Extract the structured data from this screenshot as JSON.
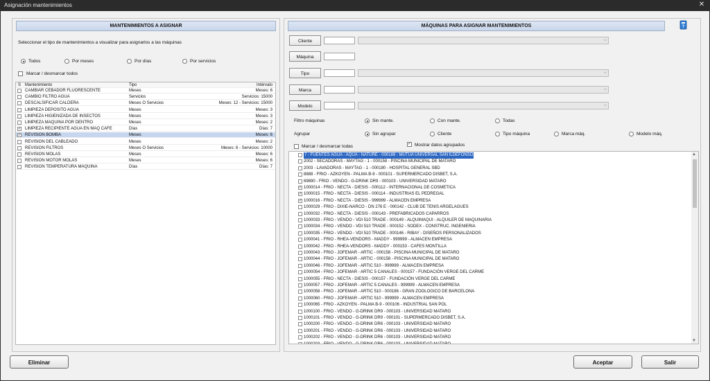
{
  "window": {
    "title": "Asignación mantenimientos"
  },
  "left": {
    "header": "MANTENIMIENTOS A ASIGNAR",
    "instruction": "Seleccionar el tipo de mantenimientos a visualizar para asignarlos a las máquinas",
    "filter_options": [
      {
        "label": "Todos",
        "selected": true
      },
      {
        "label": "Por meses",
        "selected": false
      },
      {
        "label": "Por días",
        "selected": false
      },
      {
        "label": "Por servicios",
        "selected": false
      }
    ],
    "mark_all_label": "Marcar / desmarcar todos",
    "columns": [
      "S",
      "Mantenimiento",
      "Tipo",
      "Intérvalo"
    ],
    "rows": [
      {
        "checked": false,
        "name": "CAMBIAR CEBADOR FLUORESCENTE",
        "tipo": "Meses",
        "intervalo": "Meses: 6"
      },
      {
        "checked": false,
        "name": "CAMBIO FILTRO AGUA",
        "tipo": "Servicios",
        "intervalo": "Servicios: 15000"
      },
      {
        "checked": false,
        "name": "DESCALSIFICAR CALDERA",
        "tipo": "Meses Ó Servicios",
        "intervalo": "Meses: 12 - Servicios: 15000"
      },
      {
        "checked": false,
        "name": "LIMPIEZA DEPOSITO AGUA",
        "tipo": "Meses",
        "intervalo": "Meses: 3"
      },
      {
        "checked": false,
        "name": "LIMPIEZA HIGIENIZADA DE INSECTOS",
        "tipo": "Meses",
        "intervalo": "Meses: 3"
      },
      {
        "checked": false,
        "name": "LIMPIEZA MAQUINA POR DENTRO",
        "tipo": "Meses",
        "intervalo": "Meses: 2"
      },
      {
        "checked": true,
        "name": "LIMPIEZA RECIPIENTE AGUA EN MAQ CAFE",
        "tipo": "Días",
        "intervalo": "Días: 7"
      },
      {
        "checked": true,
        "name": "REVISION BOMBA",
        "tipo": "Meses",
        "intervalo": "Meses: 6",
        "selected": true
      },
      {
        "checked": false,
        "name": "REVISIÓN DEL CABLEADO",
        "tipo": "Meses",
        "intervalo": "Meses: 2"
      },
      {
        "checked": false,
        "name": "REVISIÓN FILTROS",
        "tipo": "Meses Ó Servicios",
        "intervalo": "Meses: 6 - Servicios: 10000"
      },
      {
        "checked": false,
        "name": "REVISIÓN MOLAS",
        "tipo": "Meses",
        "intervalo": "Meses: 6"
      },
      {
        "checked": false,
        "name": "REVISIÓN MOTOR MOLAS",
        "tipo": "Meses",
        "intervalo": "Meses: 6"
      },
      {
        "checked": false,
        "name": "REVISIÓN TEMPERATURA MAQUINA",
        "tipo": "Días",
        "intervalo": "Días: 7"
      }
    ]
  },
  "right": {
    "header": "MÁQUINAS PARA ASIGNAR MANTENIMIENTOS",
    "help_icon": "help-book-icon",
    "field_buttons": [
      "Cliente",
      "Máquina",
      "Tipo",
      "Marca",
      "Modelo"
    ],
    "filtro_label": "Filtro máquinas",
    "filtro_options": [
      {
        "label": "Sin mante.",
        "selected": true
      },
      {
        "label": "Con mante.",
        "selected": false
      },
      {
        "label": "Todas",
        "selected": false
      }
    ],
    "agrupar_label": "Agrupar",
    "agrupar_options": [
      {
        "label": "Sin agrupar",
        "selected": true
      },
      {
        "label": "Cliente",
        "selected": false
      },
      {
        "label": "Tipo máquina",
        "selected": false
      },
      {
        "label": "Marca máq.",
        "selected": false
      },
      {
        "label": "Modelo máq.",
        "selected": false
      }
    ],
    "mark_all_label": "Marcar / desmarcar todas",
    "show_grouped_label": "Mostrar datos agrupados",
    "show_grouped_checked": true,
    "machines": [
      {
        "checked": false,
        "text": "7 - FUENTES AGUA - AQUA - NATURE - 000189 - MUTUA UNIVERSAL SAN ILDEFONSO",
        "highlight": true
      },
      {
        "checked": false,
        "text": "2002 - SECADORAS - MAYTAG - 1 - 000158 - PISCINA MUNICIPAL DE MATARO"
      },
      {
        "checked": false,
        "text": "2003 - LAVADORAS - MAYTAG - 1 - 000180 - HOSPITAL GENERAL SBD"
      },
      {
        "checked": false,
        "text": "8888 - FRIO - AZKOYEN - PALMA B-9 - 000101 - SUPERMERCADO DISBET, S.A."
      },
      {
        "checked": false,
        "text": "69890 - FRIO - VENDO - G-DRINK DR9 - 000103 - UNIVERSIDAD MATARO"
      },
      {
        "checked": true,
        "text": "1000014 - FRIO - NECTA - DIESIS - 000112 - INTERNACIONAL DE COSMETICA"
      },
      {
        "checked": true,
        "text": "1000015 - FRIO - NECTA - DIESIS - 000114 - INDUSTRIAS EL PEDREGAL"
      },
      {
        "checked": true,
        "text": "1000016 - FRIO - NECTA - DIESIS - 999999 - ALMACEN EMPRESA"
      },
      {
        "checked": false,
        "text": "1000029 - FRIO - DIXIE-NARCO - DN 276 E - 000142 - CLUB DE TENIS ARGELAGUES"
      },
      {
        "checked": false,
        "text": "1000032 - FRIO - NECTA - DIESIS - 000143 - PREFABRICADOS CAPARROS"
      },
      {
        "checked": false,
        "text": "1000033 - FRIO - VENDO - VDI 510 TRADE - 000149 - ALQUIMAQUI - ALQUILER DE MAQUINARIA"
      },
      {
        "checked": false,
        "text": "1000034 - FRIO - VENDO - VDI 510 TRADE - 000152 - SODEX - CONSTRUC. INGENIERIA"
      },
      {
        "checked": false,
        "text": "1000035 - FRIO - VENDO - VDI 510 TRADE - 000146 - RIBAY - DISEÑOS PERSONALIZADOS"
      },
      {
        "checked": false,
        "text": "1000041 - FRIO - RHEA-VENDORS - MADDY - 999999 - ALMACEN EMPRESA"
      },
      {
        "checked": false,
        "text": "1000042 - FRIO - RHEA-VENDORS - MADDY - 000153 - CAFES MONTILLA"
      },
      {
        "checked": false,
        "text": "1000043 - FRIO - JOFEMAR - ARTIC - 000158 - PISCINA MUNICIPAL DE MATARO"
      },
      {
        "checked": false,
        "text": "1000044 - FRIO - JOFEMAR - ARTIC - 000158 - PISCINA MUNICIPAL DE MATARO"
      },
      {
        "checked": false,
        "text": "1000046 - FRIO - JOFEMAR - ARTIC 510 - 999999 - ALMACEN EMPRESA"
      },
      {
        "checked": false,
        "text": "1000054 - FRIO - JOFEMAR - ARTIC 5 CANALES - 000157 - FUNDACIÓN VERGE DEL CARME"
      },
      {
        "checked": false,
        "text": "1000055 - FRIO - NECTA - DIESIS - 000157 - FUNDACIÓN VERGE DEL CARME"
      },
      {
        "checked": false,
        "text": "1000057 - FRIO - JOFEMAR - ARTIC 5 CANALES - 999999 - ALMACEN EMPRESA"
      },
      {
        "checked": false,
        "text": "1000058 - FRIO - JOFEMAR - ARTIC 510 - 000186 - GRAN ZOOLOGICO DE BARCELONA"
      },
      {
        "checked": false,
        "text": "1000060 - FRIO - JOFEMAR - ARTIC 510 - 999999 - ALMACEN EMPRESA"
      },
      {
        "checked": false,
        "text": "1000065 - FRIO - AZKOYEN - PALMA B-9 - 000106 - INDUSTRIAL SAN POL"
      },
      {
        "checked": false,
        "text": "1000100 - FRIO - VENDO - G-DRINK DR9 - 000103 - UNIVERSIDAD MATARO"
      },
      {
        "checked": false,
        "text": "1000101 - FRIO - VENDO - G-DRINK DR9 - 000101 - SUPERMERCADO DISBET, S.A."
      },
      {
        "checked": false,
        "text": "1000200 - FRIO - VENDO - G-DRINK DR6 - 000103 - UNIVERSIDAD MATARO"
      },
      {
        "checked": false,
        "text": "1000201 - FRIO - VENDO - G-DRINK DR6 - 000103 - UNIVERSIDAD MATARO"
      },
      {
        "checked": false,
        "text": "1000202 - FRIO - VENDO - G-DRINK DR6 - 000103 - UNIVERSIDAD MATARO"
      },
      {
        "checked": false,
        "text": "1000203 - FRIO - VENDO - G-DRINK DR6 - 000103 - UNIVERSIDAD MATARO"
      }
    ]
  },
  "buttons": {
    "eliminar": "Eliminar",
    "aceptar": "Aceptar",
    "salir": "Salir"
  }
}
